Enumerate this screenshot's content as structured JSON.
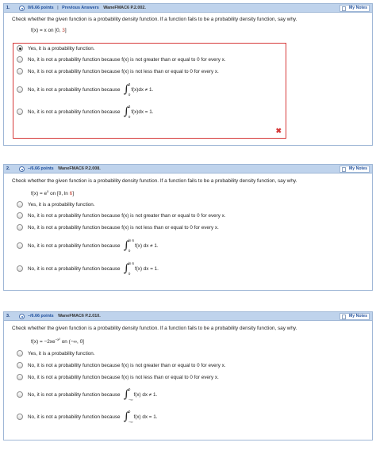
{
  "questions": [
    {
      "number": "1.",
      "points": "0/6.66 points",
      "separator": "|",
      "previous_answers": "Previous Answers",
      "source": "WaneFMAC6 P.2.002.",
      "notes_label": "My Notes",
      "prompt": "Check whether the given function is a probability density function. If a function fails to be a probability density function, say why.",
      "func_prefix": "f(x) = x on [0, ",
      "func_red": "3",
      "func_suffix": "]",
      "options": [
        "Yes, it is a probability function.",
        "No, it is not a probability function because f(x) is not greater than or equal to 0 for every x.",
        "No, it is not a probability function because f(x) is not less than or equal to 0 for every x.",
        "No, it is not a probability function because",
        "No, it is not a probability function because"
      ],
      "integral_ne": {
        "upper": "3",
        "lower": "0",
        "expr": "f(x)dx ≠ 1."
      },
      "integral_eq": {
        "upper": "3",
        "lower": "0",
        "expr": "f(x)dx = 1."
      },
      "selected_index": 0,
      "result_mark": "✖"
    },
    {
      "number": "2.",
      "points": "–/6.66 points",
      "source": "WaneFMAC6 P.2.008.",
      "notes_label": "My Notes",
      "prompt": "Check whether the given function is a probability density function. If a function fails to be a probability density function, say why.",
      "func_prefix": "f(x) = e",
      "func_sup": "x",
      "func_mid": " on [0, ln ",
      "func_red": "6",
      "func_suffix": "]",
      "options": [
        "Yes, it is a probability function.",
        "No, it is not a probability function because f(x) is not greater than or equal to 0 for every x.",
        "No, it is not a probability function because f(x) is not less than or equal to 0 for every x.",
        "No, it is not a probability function because",
        "No, it is not a probability function because"
      ],
      "integral_ne": {
        "upper": "ln 6",
        "lower": "0",
        "expr": "f(x) dx ≠ 1."
      },
      "integral_eq": {
        "upper": "ln 6",
        "lower": "0",
        "expr": "f(x) dx = 1."
      }
    },
    {
      "number": "3.",
      "points": "–/6.66 points",
      "source": "WaneFMAC6 P.2.010.",
      "notes_label": "My Notes",
      "prompt": "Check whether the given function is a probability density function. If a function fails to be a probability density function, say why.",
      "func_prefix": "f(x) = −2xe",
      "func_sup": "−x²",
      "func_suffix": " on (−∞, 0]",
      "options": [
        "Yes, it is a probability function.",
        "No, it is not a probability function because f(x) is not greater than or equal to 0 for every x.",
        "No, it is not a probability function because f(x) is not less than or equal to 0 for every x.",
        "No, it is not a probability function because",
        "No, it is not a probability function because"
      ],
      "integral_ne": {
        "upper": "0",
        "lower": "−∞",
        "expr": "f(x) dx ≠ 1."
      },
      "integral_eq": {
        "upper": "0",
        "lower": "−∞",
        "expr": "f(x) dx = 1."
      }
    }
  ]
}
